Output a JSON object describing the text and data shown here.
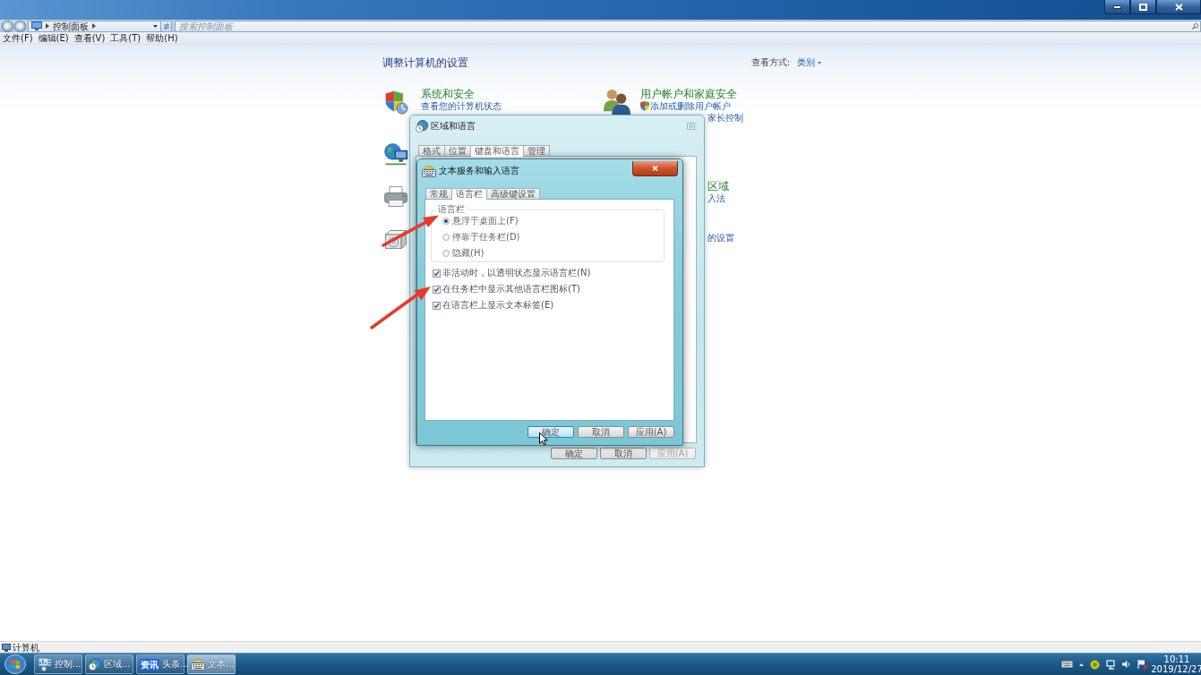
{
  "address_bar": {
    "path": [
      "控制面板"
    ]
  },
  "search": {
    "placeholder": "搜索控制面板"
  },
  "menu_bar": [
    "文件(F)",
    "编辑(E)",
    "查看(V)",
    "工具(T)",
    "帮助(H)"
  ],
  "control_panel": {
    "heading": "调整计算机的设置",
    "view_by": {
      "label": "查看方式:",
      "value": "类别"
    },
    "left_column": [
      {
        "kind": "category",
        "title": "系统和安全",
        "links": [
          {
            "kind": "plain",
            "text": "查看您的计算机状态"
          }
        ]
      },
      {
        "kind": "covered"
      },
      {
        "kind": "covered"
      },
      {
        "kind": "covered"
      }
    ],
    "right_column": [
      {
        "kind": "category",
        "title": "用户帐户和家庭安全",
        "links": [
          {
            "kind": "admin",
            "text": "添加或删除用户帐户"
          },
          {
            "kind": "clipped",
            "text": "家长控制"
          }
        ]
      },
      {
        "kind": "clipped",
        "title": "区域",
        "links": [
          {
            "kind": "clipped",
            "text": "入法"
          }
        ]
      },
      {
        "kind": "clipped",
        "links": [
          {
            "kind": "clipped",
            "text": "的设置"
          }
        ]
      }
    ]
  },
  "region_dialog": {
    "title": "区域和语言",
    "tabs": [
      {
        "label": "格式",
        "selected": false
      },
      {
        "label": "位置",
        "selected": false
      },
      {
        "label": "键盘和语言",
        "selected": true
      },
      {
        "label": "管理",
        "selected": false
      }
    ],
    "buttons": [
      {
        "label": "确定",
        "disabled": false,
        "hovered": false
      },
      {
        "label": "取消",
        "disabled": false,
        "hovered": false
      },
      {
        "label": "应用(A)",
        "disabled": true,
        "hovered": false
      }
    ]
  },
  "text_services_dialog": {
    "title": "文本服务和输入语言",
    "tabs": [
      {
        "label": "常规",
        "selected": false
      },
      {
        "label": "语言栏",
        "selected": true
      },
      {
        "label": "高级键设置",
        "selected": false
      }
    ],
    "group": {
      "label": "语言栏",
      "options": [
        {
          "label": "悬浮于桌面上(F)",
          "selected": true
        },
        {
          "label": "停靠于任务栏(D)",
          "selected": false
        },
        {
          "label": "隐藏(H)",
          "selected": false
        }
      ]
    },
    "checkboxes": [
      {
        "label": "非活动时，以透明状态显示语言栏(N)",
        "checked": true
      },
      {
        "label": "在任务栏中显示其他语言栏图标(T)",
        "checked": true
      },
      {
        "label": "在语言栏上显示文本标签(E)",
        "checked": true
      }
    ],
    "buttons": [
      {
        "label": "确定",
        "disabled": false,
        "hovered": true
      },
      {
        "label": "取消",
        "disabled": false,
        "hovered": false
      },
      {
        "label": "应用(A)",
        "disabled": false,
        "hovered": false
      }
    ]
  },
  "status_bar": {
    "text": "计算机"
  },
  "taskbar": {
    "items": [
      {
        "label": "控制...",
        "selected": false
      },
      {
        "label": "区域...",
        "selected": false
      },
      {
        "label": "头条...",
        "badge": "资讯",
        "selected": false
      },
      {
        "label": "文本...",
        "selected": true
      }
    ],
    "clock": {
      "time": "10:11",
      "date": "2019/12/27"
    }
  }
}
